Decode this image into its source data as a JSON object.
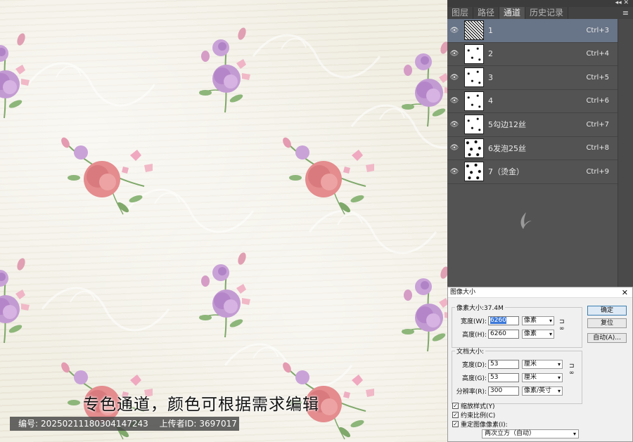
{
  "canvas": {
    "caption": "专色通道，颜色可根据需求编辑",
    "watermark": {
      "id_label": "编号:",
      "id_value": "20250211180304147243",
      "uploader_label": "上传者ID:",
      "uploader_value": "3697017"
    }
  },
  "panel": {
    "tabs": [
      {
        "label": "图层"
      },
      {
        "label": "路径"
      },
      {
        "label": "通道"
      },
      {
        "label": "历史记录"
      }
    ],
    "active_tab": "通道",
    "channels": [
      {
        "name": "1",
        "shortcut": "Ctrl+3"
      },
      {
        "name": "2",
        "shortcut": "Ctrl+4"
      },
      {
        "name": "3",
        "shortcut": "Ctrl+5"
      },
      {
        "name": "4",
        "shortcut": "Ctrl+6"
      },
      {
        "name": "5勾边12丝",
        "shortcut": "Ctrl+7"
      },
      {
        "name": "6发泡25丝",
        "shortcut": "Ctrl+8"
      },
      {
        "name": "7（烫金）",
        "shortcut": "Ctrl+9"
      }
    ],
    "selected_channel": "1"
  },
  "dialog": {
    "title": "图像大小",
    "pixel_group": {
      "label": "像素大小:37.4M",
      "width_label": "宽度(W):",
      "width_value": "6260",
      "width_unit": "像素",
      "height_label": "高度(H):",
      "height_value": "6260",
      "height_unit": "像素"
    },
    "doc_group": {
      "label": "文档大小:",
      "width_label": "宽度(D):",
      "width_value": "53",
      "width_unit": "厘米",
      "height_label": "高度(G):",
      "height_value": "53",
      "height_unit": "厘米",
      "res_label": "分辨率(R):",
      "res_value": "300",
      "res_unit": "像素/英寸"
    },
    "buttons": {
      "ok": "确定",
      "reset": "复位",
      "auto": "自动(A)..."
    },
    "checkboxes": [
      {
        "label": "缩放样式(Y)",
        "checked": true
      },
      {
        "label": "约束比例(C)",
        "checked": true
      },
      {
        "label": "重定图像像素(I):",
        "checked": true
      }
    ],
    "resample_value": "两次立方（自动）"
  },
  "colors": {
    "panel_bg": "#535353",
    "selected_row": "#687487",
    "rose_pink": "#e48c8e",
    "lilac": "#c39bd3",
    "leaf_green": "#7fa86a"
  }
}
